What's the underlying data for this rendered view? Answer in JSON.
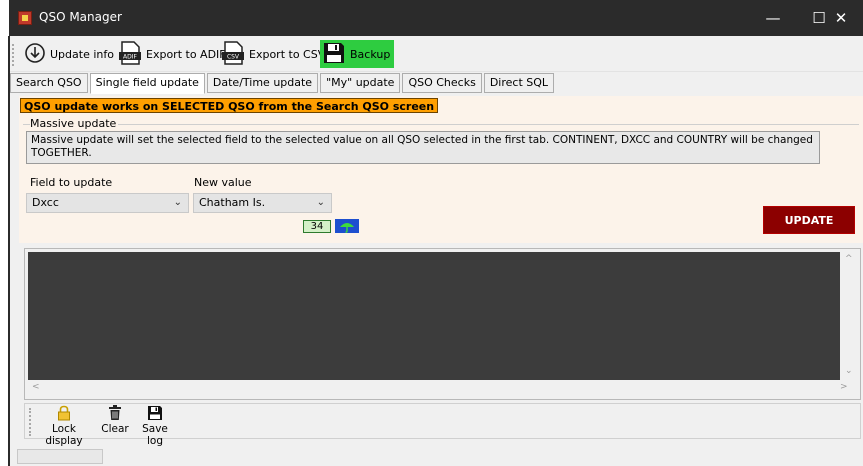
{
  "window": {
    "title": "QSO Manager",
    "minimize": "—",
    "maximize": "☐",
    "close": "✕"
  },
  "toolbar": {
    "update_info": "Update info",
    "export_adif": "Export to ADIF",
    "export_csv": "Export to CSV",
    "backup": "Backup"
  },
  "tabs": [
    {
      "label": "Search QSO"
    },
    {
      "label": "Single field update"
    },
    {
      "label": "Date/Time update"
    },
    {
      "label": "\"My\" update"
    },
    {
      "label": "QSO Checks"
    },
    {
      "label": "Direct SQL"
    }
  ],
  "panel": {
    "warning": "QSO update works on SELECTED QSO from the Search QSO screen",
    "group_title": "Massive update",
    "description": "Massive update will set the selected field to the selected value on all QSO selected in the first tab. CONTINENT, DXCC and COUNTRY will be changed TOGETHER.",
    "field_label": "Field to update",
    "field_value": "Dxcc",
    "value_label": "New value",
    "value_value": "Chatham Is.",
    "counter": "34",
    "update_button": "UPDATE"
  },
  "log_toolbar": {
    "lock": "Lock display",
    "clear": "Clear",
    "save": "Save log"
  },
  "colors": {
    "backup": "#2ecc40",
    "warning": "#ff9f00",
    "update": "#8c0000",
    "log_bg": "#3c3c3c"
  }
}
